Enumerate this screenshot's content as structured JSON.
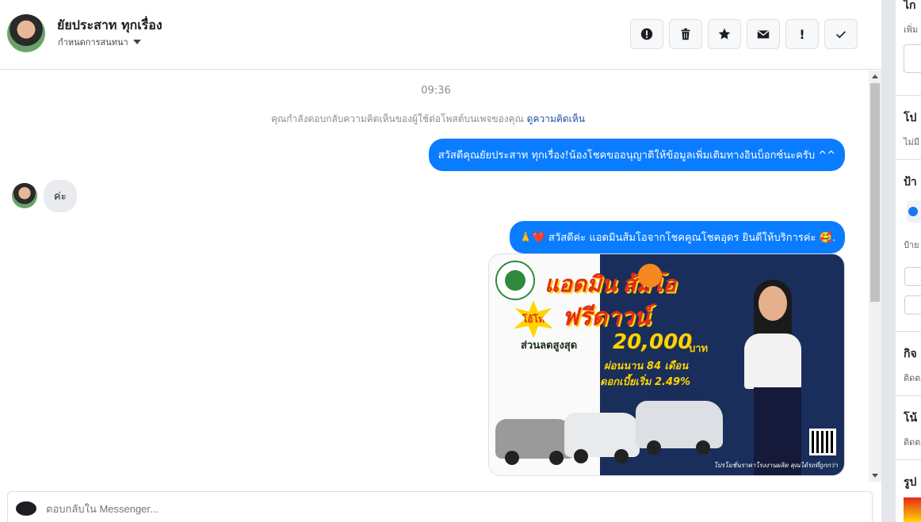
{
  "header": {
    "contact_name": "ยัยประสาท ทุกเรื่อง",
    "status_label": "กำหนดการสนทนา",
    "actions": [
      {
        "name": "report-button",
        "icon": "exclamation-circle-icon",
        "label": ""
      },
      {
        "name": "delete-button",
        "icon": "trash-icon",
        "label": ""
      },
      {
        "name": "star-button",
        "icon": "star-icon",
        "label": ""
      },
      {
        "name": "mail-button",
        "icon": "envelope-icon",
        "label": ""
      },
      {
        "name": "important-button",
        "icon": "exclamation-icon",
        "label": "!"
      },
      {
        "name": "done-button",
        "icon": "check-icon",
        "label": ""
      }
    ]
  },
  "messages": {
    "time": "09:36",
    "notice_text": "คุณกำลังตอบกลับความคิดเห็นของผู้ใช้ต่อโพสต์บนเพจของคุณ",
    "notice_link": "ดูความคิดเห็น",
    "out_1": "สวัสดีคุณยัยประสาท ทุกเรื่อง!น้องโชคขออนุญาติให้ข้อมูลเพิ่มเติมทางอินบ็อกซ์นะครับ ^^",
    "in_1": "ค่ะ",
    "out_2": "🙏❤️ สวัสดีค่ะ แอดมินส้มโอจากโชคคูณโชคอุดร ยินดีให้บริการค่ะ 🥰."
  },
  "promo_image": {
    "headline": "แอดมิน ส้มโอ",
    "burst": "โอ้โห",
    "free_down": "ฟรีดาวน์",
    "discount_label": "ส่วนลดสูงสุด",
    "discount_amount": "20,000",
    "currency": "บาท",
    "installment": "ผ่อนนาน 84 เดือน",
    "interest": "ดอกเบี้ยเริ่ม 2.49%",
    "footer": "โปรโมชั่นราคาโรงงานผลิต คุณได้รถที่ถูกกว่า"
  },
  "composer": {
    "placeholder": "ตอบกลับใน Messenger..."
  },
  "right_panel": {
    "sec1_title": "ไก",
    "sec1_sub": "เพิ่ม",
    "sec2_title": "โป",
    "sec2_sub": "ไม่มี",
    "sec3_title": "ป้า",
    "sec3_sub": "ป้าย",
    "sec4_title": "กิจ",
    "sec4_sub": "ติดต",
    "sec5_title": "โน้",
    "sec5_sub": "ติดต",
    "sec6_title": "รูป"
  },
  "colors": {
    "outgoing_bubble": "#0a7cff",
    "incoming_bubble": "#e9ebee",
    "link": "#1b4fa0"
  }
}
